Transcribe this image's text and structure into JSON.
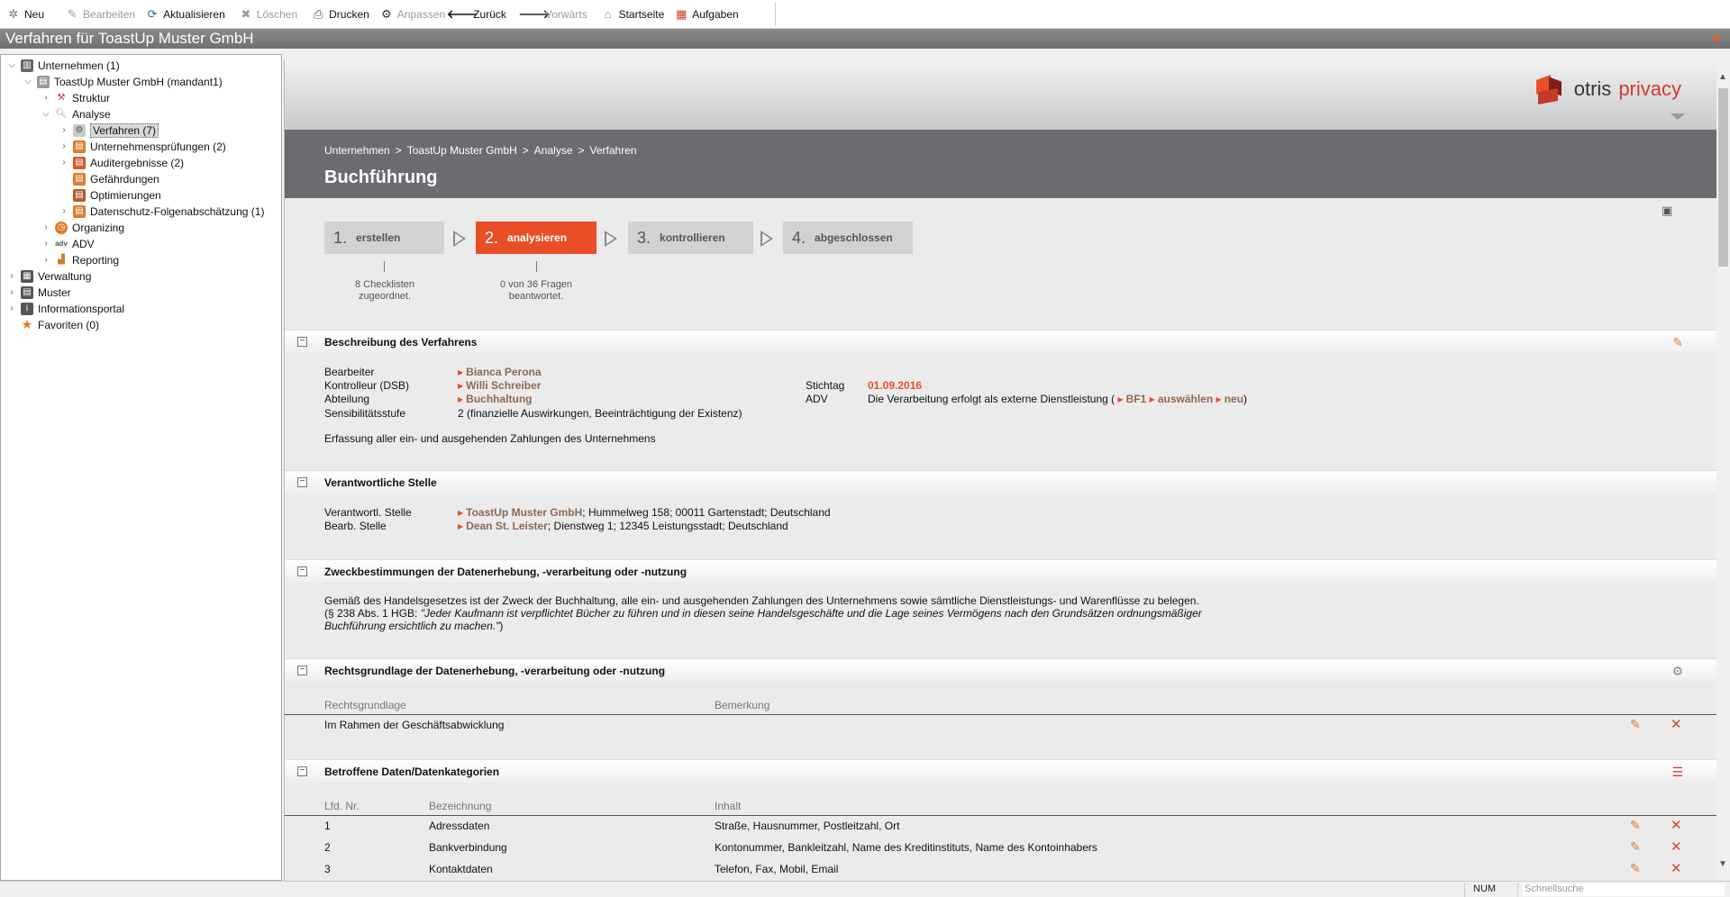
{
  "toolbar": {
    "new": "Neu",
    "edit": "Bearbeiten",
    "refresh": "Aktualisieren",
    "delete": "Löschen",
    "print": "Drucken",
    "customize": "Anpassen",
    "back": "Zurück",
    "forward": "Vorwärts",
    "home": "Startseite",
    "tasks": "Aufgaben"
  },
  "window_title": "Verfahren für ToastUp Muster GmbH",
  "tree": {
    "companies": "Unternehmen (1)",
    "company": "ToastUp Muster GmbH (mandant1)",
    "structure": "Struktur",
    "analysis": "Analyse",
    "procedures": "Verfahren (7)",
    "audits": "Unternehmensprüfungen (2)",
    "audit_results": "Auditergebnisse (2)",
    "hazards": "Gefährdungen",
    "optimizations": "Optimierungen",
    "dpia": "Datenschutz-Folgenabschätzung (1)",
    "organizing": "Organizing",
    "adv": "ADV",
    "reporting": "Reporting",
    "administration": "Verwaltung",
    "templates": "Muster",
    "info_portal": "Informationsportal",
    "favorites": "Favoriten (0)"
  },
  "brand": {
    "otris": "otris",
    "privacy": "privacy",
    "color": "#d33a2e"
  },
  "breadcrumb": [
    "Unternehmen",
    ">",
    "ToastUp Muster GmbH",
    ">",
    "Analyse",
    ">",
    "Verfahren"
  ],
  "page_title": "Buchführung",
  "steps": [
    {
      "num": "1.",
      "label": "erstellen",
      "note1": "8 Checklisten",
      "note2": "zugeordnet."
    },
    {
      "num": "2.",
      "label": "analysieren",
      "note1": "0 von 36 Fragen",
      "note2": "beantwortet."
    },
    {
      "num": "3.",
      "label": "kontrollieren"
    },
    {
      "num": "4.",
      "label": "abgeschlossen"
    }
  ],
  "accent_color": "#e94e27",
  "description": {
    "title": "Beschreibung des Verfahrens",
    "editor_label": "Bearbeiter",
    "editor_value": "Bianca Perona",
    "controller_label": "Kontrolleur (DSB)",
    "controller_value": "Willi Schreiber",
    "department_label": "Abteilung",
    "department_value": "Buchhaltung",
    "sensitivity_label": "Sensibilitätsstufe",
    "sensitivity_value": "2 (finanzielle Auswirkungen, Beeinträchtigung der Existenz)",
    "date_label": "Stichtag",
    "date_value": "01.09.2016",
    "adv_label": "ADV",
    "adv_text": "Die Verarbeitung erfolgt als externe Dienstleistung (",
    "adv_bf1": "BF1",
    "adv_select": "auswählen",
    "adv_new": "neu",
    "adv_close": ")",
    "summary": "Erfassung aller ein- und ausgehenden Zahlungen des Unternehmens"
  },
  "responsible": {
    "title": "Verantwortliche Stelle",
    "resp_label": "Verantwortl. Stelle",
    "resp_link": "ToastUp Muster GmbH",
    "resp_addr": "; Hummelweg 158; 00011 Gartenstadt; Deutschland",
    "proc_label": "Bearb. Stelle",
    "proc_link": "Dean St. Leister",
    "proc_addr": "; Dienstweg 1; 12345 Leistungsstadt; Deutschland"
  },
  "purpose": {
    "title": "Zweckbestimmungen der Datenerhebung, -verarbeitung oder -nutzung",
    "line1": "Gemäß des Handelsgesetzes ist der Zweck der Buchhaltung, alle ein- und ausgehenden Zahlungen des Unternehmens sowie sämtliche Dienstleistungs- und Warenflüsse zu belegen.",
    "line2_prefix": "(§ 238 Abs. 1 HGB: ",
    "line2_italic": "\"Jeder Kaufmann ist verpflichtet Bücher zu führen und in diesen seine Handelsgeschäfte und die Lage seines Vermögens nach den Grundsätzen ordnungsmäßiger",
    "line3_italic": "Buchführung ersichtlich zu machen.\"",
    "line3_suffix": ")"
  },
  "legal": {
    "title": "Rechtsgrundlage der Datenerhebung, -verarbeitung oder -nutzung",
    "col_basis": "Rechtsgrundlage",
    "col_note": "Bemerkung",
    "rows": [
      {
        "basis": "Im Rahmen der Geschäftsabwicklung",
        "note": ""
      }
    ]
  },
  "data_categories": {
    "title": "Betroffene Daten/Datenkategorien",
    "col_no": "Lfd. Nr.",
    "col_name": "Bezeichnung",
    "col_content": "Inhalt",
    "rows": [
      {
        "no": "1",
        "name": "Adressdaten",
        "content": "Straße, Hausnummer, Postleitzahl, Ort"
      },
      {
        "no": "2",
        "name": "Bankverbindung",
        "content": "Kontonummer, Bankleitzahl, Name des Kreditinstituts, Name des Kontoinhabers"
      },
      {
        "no": "3",
        "name": "Kontaktdaten",
        "content": "Telefon, Fax, Mobil, Email"
      }
    ]
  },
  "statusbar": {
    "num": "NUM",
    "search_placeholder": "Schnellsuche"
  }
}
